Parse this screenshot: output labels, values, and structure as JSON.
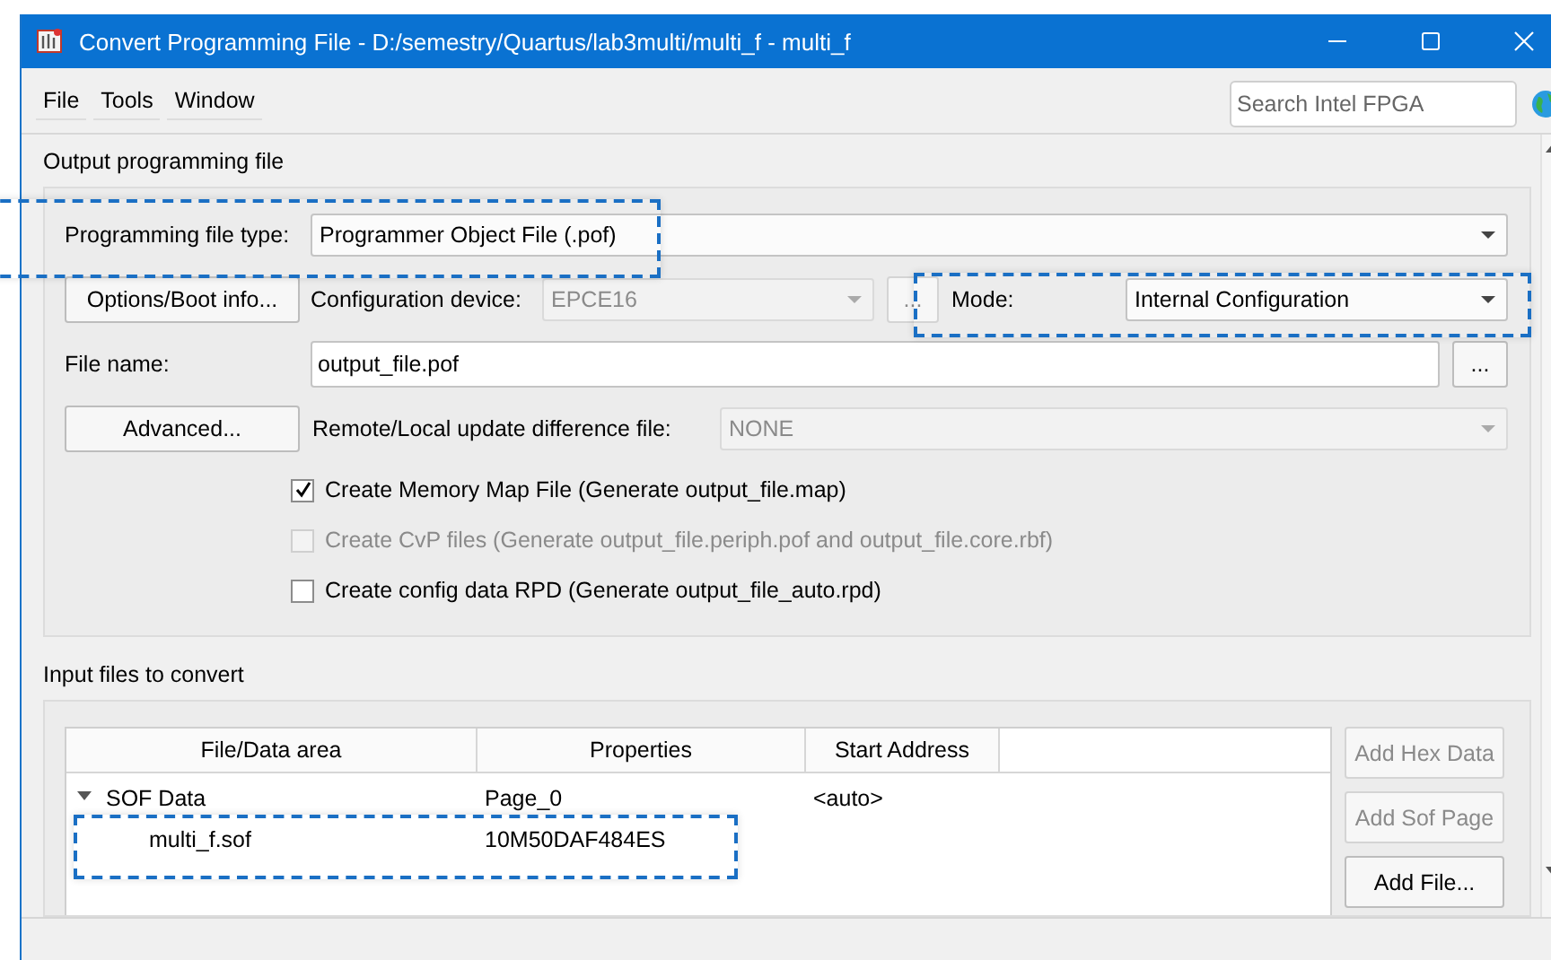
{
  "window": {
    "title": "Convert Programming File - D:/semestry/Quartus/lab3multi/multi_f - multi_f"
  },
  "menu": [
    {
      "label": "File"
    },
    {
      "label": "Tools"
    },
    {
      "label": "Window"
    }
  ],
  "search": {
    "placeholder": "Search Intel FPGA"
  },
  "output_group": {
    "title": "Output programming file",
    "programming_file_type": {
      "label": "Programming file type:",
      "value": "Programmer Object File (.pof)",
      "highlighted": true
    },
    "options_button": "Options/Boot info...",
    "configuration_device": {
      "label": "Configuration device:",
      "value": "EPCE16",
      "disabled": true
    },
    "device_browse_button": {
      "label": "...",
      "disabled": true
    },
    "mode": {
      "label": "Mode:",
      "value": "Internal Configuration",
      "highlighted": true
    },
    "file_name": {
      "label": "File name:",
      "value": "output_file.pof"
    },
    "file_browse_button": "...",
    "advanced_button": "Advanced...",
    "remote_update": {
      "label": "Remote/Local update difference file:",
      "value": "NONE",
      "disabled": true
    },
    "options": [
      {
        "label": "Create Memory Map File (Generate output_file.map)",
        "checked": true,
        "disabled": false
      },
      {
        "label": "Create CvP files (Generate output_file.periph.pof and output_file.core.rbf)",
        "checked": false,
        "disabled": true
      },
      {
        "label": "Create config data RPD (Generate output_file_auto.rpd)",
        "checked": false,
        "disabled": false
      }
    ]
  },
  "input_group": {
    "title": "Input files to convert",
    "table": {
      "columns": [
        "File/Data area",
        "Properties",
        "Start Address"
      ],
      "rows": [
        {
          "cells": [
            "SOF Data",
            "Page_0",
            "<auto>"
          ],
          "expanded": true,
          "children": [
            {
              "cells": [
                "multi_f.sof",
                "10M50DAF484ES",
                ""
              ],
              "highlighted": true
            }
          ]
        }
      ]
    },
    "buttons": [
      {
        "label": "Add Hex Data",
        "disabled": true
      },
      {
        "label": "Add Sof Page",
        "disabled": true
      },
      {
        "label": "Add File...",
        "disabled": false
      }
    ]
  }
}
